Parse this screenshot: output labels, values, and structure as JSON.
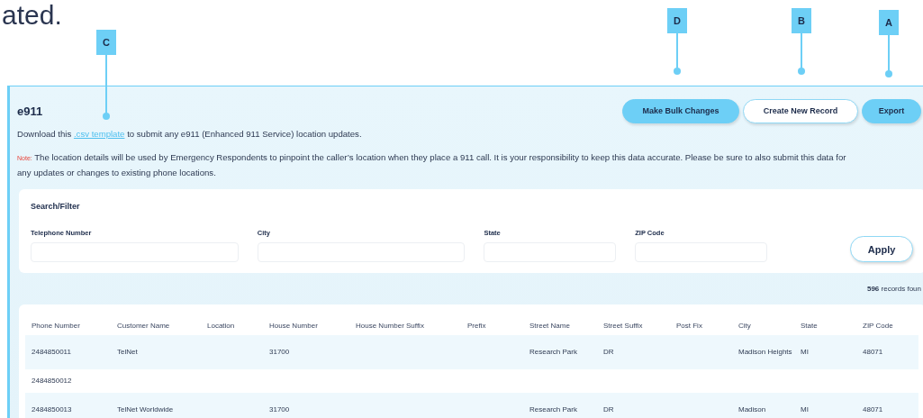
{
  "heading_fragment": "ated.",
  "callouts": [
    {
      "letter": "C"
    },
    {
      "letter": "D"
    },
    {
      "letter": "B"
    },
    {
      "letter": "A"
    }
  ],
  "panel": {
    "title": "e911",
    "buttons": [
      {
        "label": "Make Bulk Changes",
        "kind": "filled"
      },
      {
        "label": "Create New Record",
        "kind": "outline"
      },
      {
        "label": "Export",
        "kind": "filled"
      }
    ],
    "download": {
      "before": "Download this",
      "link": ".csv template",
      "after": "to submit any e911 (Enhanced 911 Service) location updates."
    },
    "note": {
      "label": "Note:",
      "lines": [
        "The location details will be used by Emergency Respondents to pinpoint the caller’s location when they place a 911 call. It is your responsibility to keep this data accurate. Please be sure to also submit this data for",
        "any updates or changes to existing phone locations."
      ]
    }
  },
  "search": {
    "title": "Search/Filter",
    "fields": [
      {
        "label": "Telephone Number"
      },
      {
        "label": "City"
      },
      {
        "label": "State"
      },
      {
        "label": "ZIP Code"
      }
    ],
    "apply": "Apply"
  },
  "records": {
    "count": "596",
    "text": "records foun"
  },
  "table": {
    "columns": [
      "Phone Number",
      "Customer Name",
      "Location",
      "House Number",
      "House Number Suffix",
      "Prefix",
      "Street Name",
      "Street Suffix",
      "Post Fix",
      "City",
      "State",
      "ZIP Code"
    ],
    "rows": [
      {
        "cells": [
          "2484850011",
          "TelNet",
          "",
          "31700",
          "",
          "",
          "Research Park",
          "DR",
          "",
          "Madison Heights",
          "MI",
          "48071"
        ]
      },
      {
        "cells": [
          "2484850012",
          "",
          "",
          "",
          "",
          "",
          "",
          "",
          "",
          "",
          "",
          ""
        ]
      },
      {
        "cells": [
          "2484850013",
          "TelNet Worldwide",
          "",
          "31700",
          "",
          "",
          "Research Park",
          "DR",
          "",
          "Madison",
          "MI",
          "48071"
        ]
      }
    ]
  }
}
